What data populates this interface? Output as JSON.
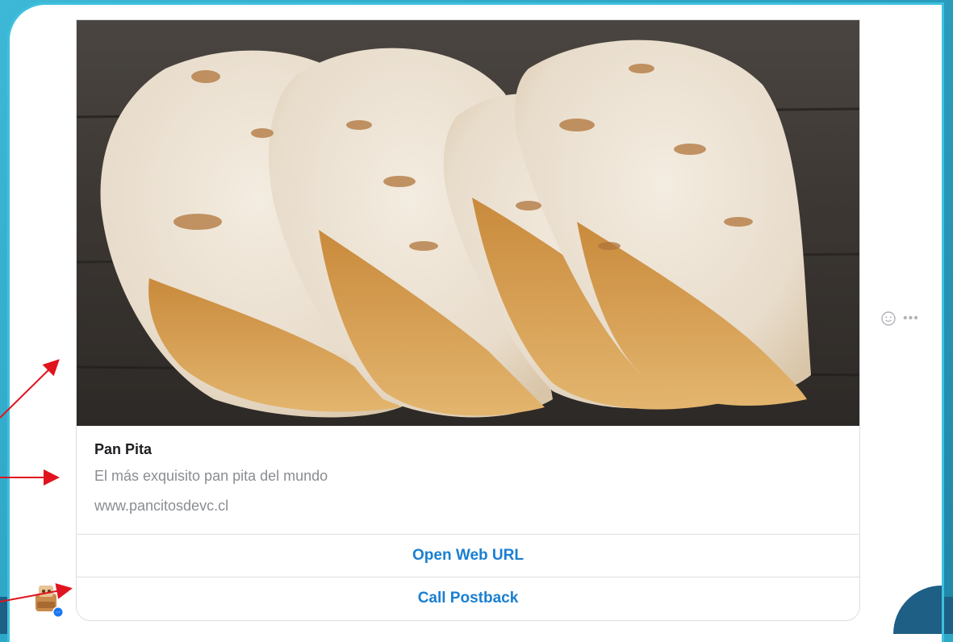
{
  "card": {
    "title": "Pan Pita",
    "subtitle": "El más exquisito pan pita del mundo",
    "url": "www.pancitosdevc.cl",
    "buttons": [
      {
        "label": "Open Web URL"
      },
      {
        "label": "Call Postback"
      }
    ],
    "image_icon": "flatbread-photo"
  },
  "side_actions": {
    "react_icon": "smiley-icon",
    "more_label": "•••"
  },
  "sender": {
    "avatar_icon": "bot-avatar",
    "badge_icon": "messenger-badge"
  },
  "colors": {
    "slide_bg": "#2ca8c8",
    "button_text": "#1a7fd1",
    "annotation_arrow": "#e0141e"
  }
}
